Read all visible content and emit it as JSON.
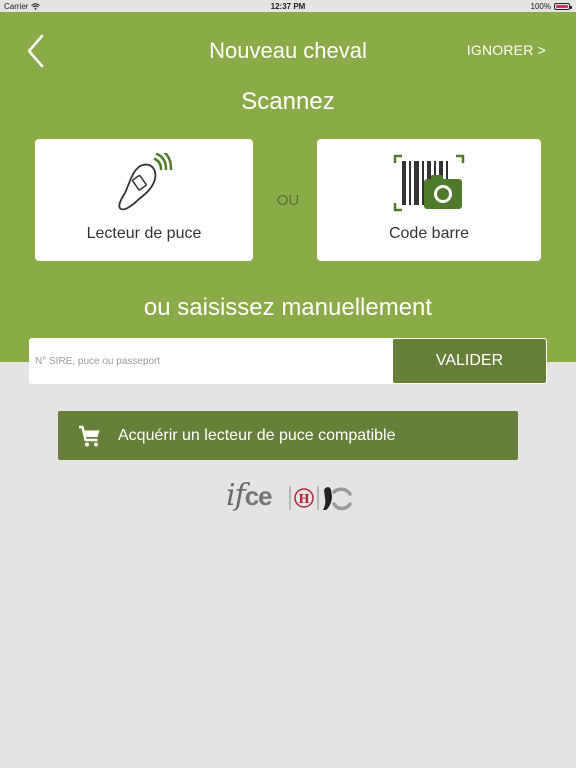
{
  "status_bar": {
    "carrier": "Carrier",
    "time": "12:37 PM",
    "battery": "100%"
  },
  "nav": {
    "title": "Nouveau cheval",
    "skip_label": "IGNORER >"
  },
  "scan": {
    "title": "Scannez",
    "rfid_label": "Lecteur de puce",
    "or_label": "OU",
    "barcode_label": "Code barre"
  },
  "manual": {
    "title": "ou saisissez manuellement",
    "placeholder": "N° SIRE, puce ou passeport",
    "value": "",
    "validate_label": "VALIDER"
  },
  "buy": {
    "label": "Acquérir un lecteur de puce compatible"
  },
  "logo": {
    "text_if": "if",
    "text_ce": "ce"
  },
  "colors": {
    "header_green": "#8aab47",
    "button_green": "#66803a",
    "icon_green": "#4e7a2a",
    "background": "#e4e4e4"
  }
}
